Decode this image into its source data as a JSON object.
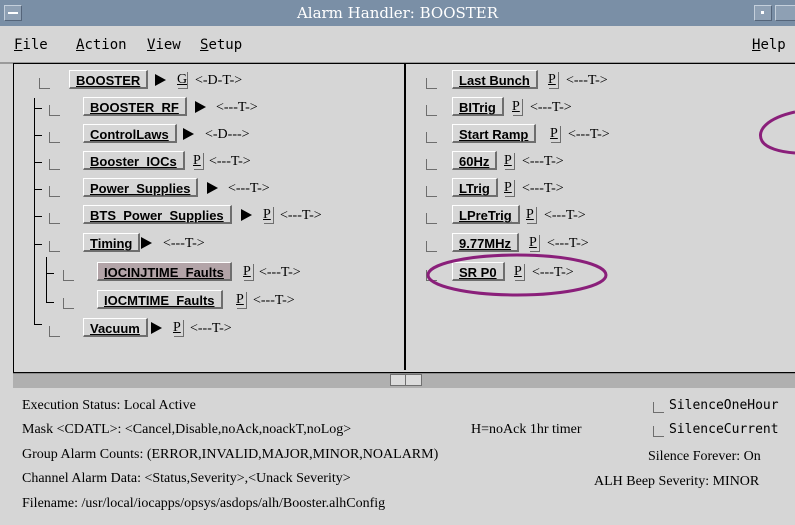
{
  "window": {
    "title": "Alarm Handler: BOOSTER"
  },
  "menubar": {
    "file": "File",
    "action": "Action",
    "view": "View",
    "setup": "Setup",
    "help": "Help"
  },
  "tree": {
    "root": {
      "label": "BOOSTER",
      "flag": "G",
      "status": "<-D-T->"
    },
    "items": [
      {
        "label": "BOOSTER_RF",
        "status": "<---T->"
      },
      {
        "label": "ControlLaws",
        "status": "<-D--->"
      },
      {
        "label": "Booster_IOCs",
        "flag": "P",
        "status": "<---T->"
      },
      {
        "label": "Power_Supplies",
        "status": "<---T->"
      },
      {
        "label": "BTS_Power_Supplies",
        "flag": "P",
        "status": "<---T->"
      },
      {
        "label": "Timing",
        "status": "<---T->"
      },
      {
        "label": "IOCINJTIME_Faults",
        "flag": "P",
        "status": "<---T->"
      },
      {
        "label": "IOCMTIME_Faults",
        "flag": "P",
        "status": "<---T->"
      },
      {
        "label": "Vacuum",
        "flag": "P",
        "status": "<---T->"
      }
    ]
  },
  "channels": [
    {
      "label": "Last Bunch",
      "flag": "P",
      "status": "<---T->"
    },
    {
      "label": "BITrig",
      "flag": "P",
      "status": "<---T->"
    },
    {
      "label": "Start Ramp",
      "flag": "P",
      "status": "<---T->"
    },
    {
      "label": "60Hz",
      "flag": "P",
      "status": "<---T->"
    },
    {
      "label": "LTrig",
      "flag": "P",
      "status": "<---T->"
    },
    {
      "label": "LPreTrig",
      "flag": "P",
      "status": "<---T->"
    },
    {
      "label": "9.77MHz",
      "flag": "P",
      "status": "<---T->"
    },
    {
      "label": "SR P0",
      "flag": "P",
      "status": "<---T->"
    }
  ],
  "info": {
    "execution": "Execution Status:  Local Active",
    "mask": "Mask <CDATL>:  <Cancel,Disable,noAck,noackT,noLog>",
    "hnoack": "H=noAck 1hr timer",
    "group": "Group Alarm Counts:  (ERROR,INVALID,MAJOR,MINOR,NOALARM)",
    "channel": "Channel Alarm Data:  <Status,Severity>,<Unack Severity>",
    "filename": "Filename:   /usr/local/iocapps/opsys/asdops/alh/Booster.alhConfig",
    "silence_one_hour": "SilenceOneHour",
    "silence_current": "SilenceCurrent",
    "silence_forever": "Silence Forever:  On",
    "beep": "ALH Beep Severity:  MINOR"
  },
  "colors": {
    "titlebar": "#7a8fa6",
    "background": "#d6d6d6",
    "selected": "#b3a4a8",
    "annotation": "#8a1f7a"
  }
}
